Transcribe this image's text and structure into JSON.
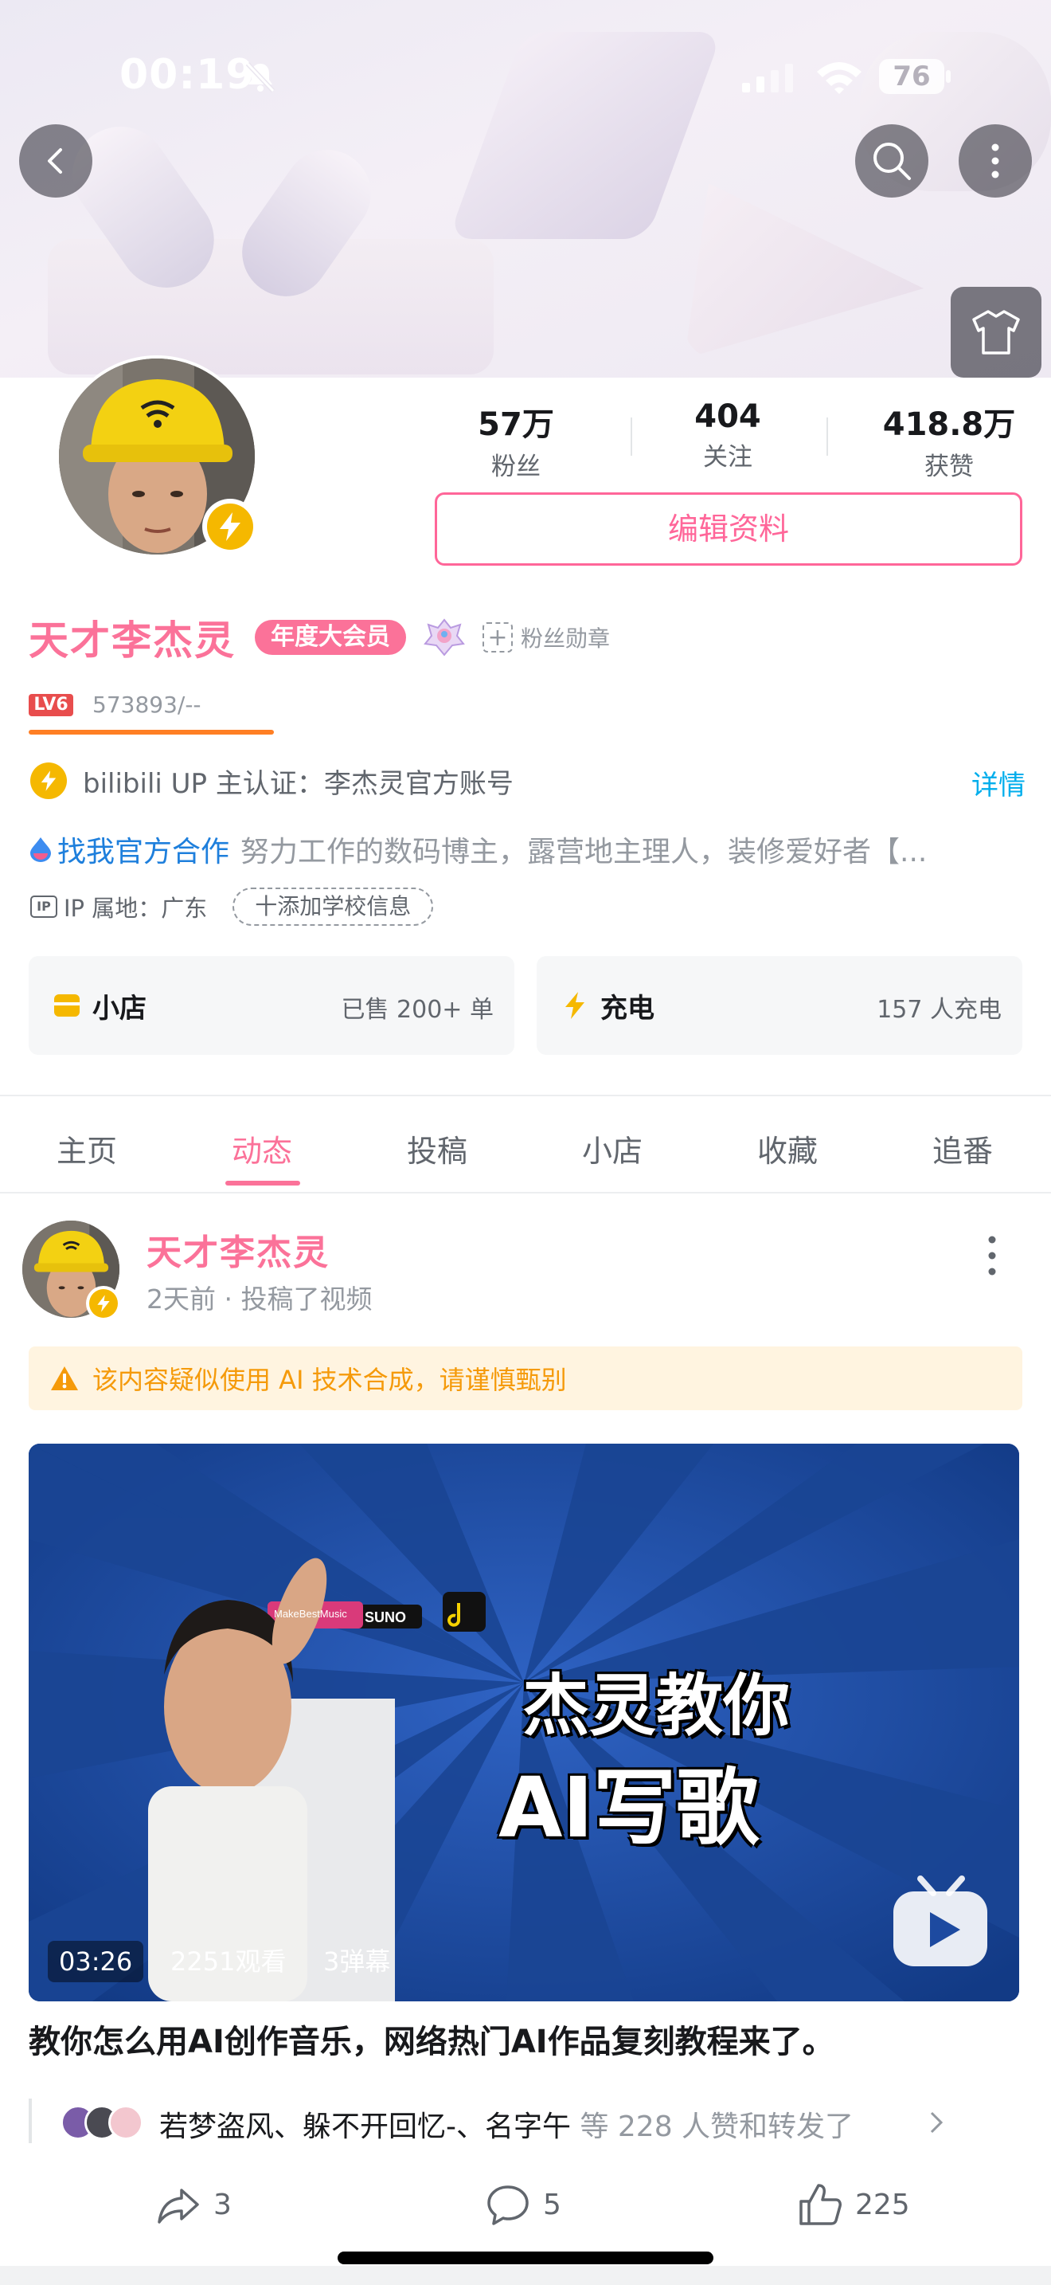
{
  "status_bar": {
    "time": "00:19",
    "battery": "76"
  },
  "profile": {
    "name": "天才李杰灵",
    "vip_label": "年度大会员",
    "fan_medal_label": "粉丝勋章",
    "level_label": "LV6",
    "level_exp": "573893/--",
    "stats": [
      {
        "value": "57万",
        "label": "粉丝"
      },
      {
        "value": "404",
        "label": "关注"
      },
      {
        "value": "418.8万",
        "label": "获赞"
      }
    ],
    "edit_label": "编辑资料",
    "certification": "bilibili UP 主认证：李杰灵官方账号",
    "cert_detail": "详情",
    "coop_link": "找我官方合作",
    "sign": "努力工作的数码博主，露营地主理人，装修爱好者【...",
    "ip_badge": "IP",
    "ip_location": "IP 属地：广东",
    "school_button": "十添加学校信息"
  },
  "cards": {
    "shop": {
      "title": "小店",
      "meta": "已售 200+ 单"
    },
    "charge": {
      "title": "充电",
      "meta": "157 人充电"
    }
  },
  "tabs": [
    "主页",
    "动态",
    "投稿",
    "小店",
    "收藏",
    "追番"
  ],
  "active_tab": "动态",
  "post": {
    "author": "天才李杰灵",
    "time": "2天前 · 投稿了视频",
    "ai_notice": "该内容疑似使用 AI 技术合成，请谨慎甄别",
    "video": {
      "duration": "03:26",
      "views": "2251观看",
      "danmaku": "3弹幕",
      "thumb_line1": "杰灵教你",
      "thumb_line2": "AI写歌",
      "thumb_tag1": "MakeBestMusic",
      "thumb_tag2": "SUNO"
    },
    "title": "教你怎么用AI创作音乐，网络热门AI作品复刻教程来了。",
    "likers": "若梦盗风、躲不开回忆-、名字午",
    "likers_tail": " 等 228 人赞和转发了",
    "actions": {
      "share": "3",
      "comment": "5",
      "like": "225"
    }
  },
  "colors": {
    "accent": "#fb7299",
    "link": "#00aeec",
    "warning": "#f59a0a"
  }
}
